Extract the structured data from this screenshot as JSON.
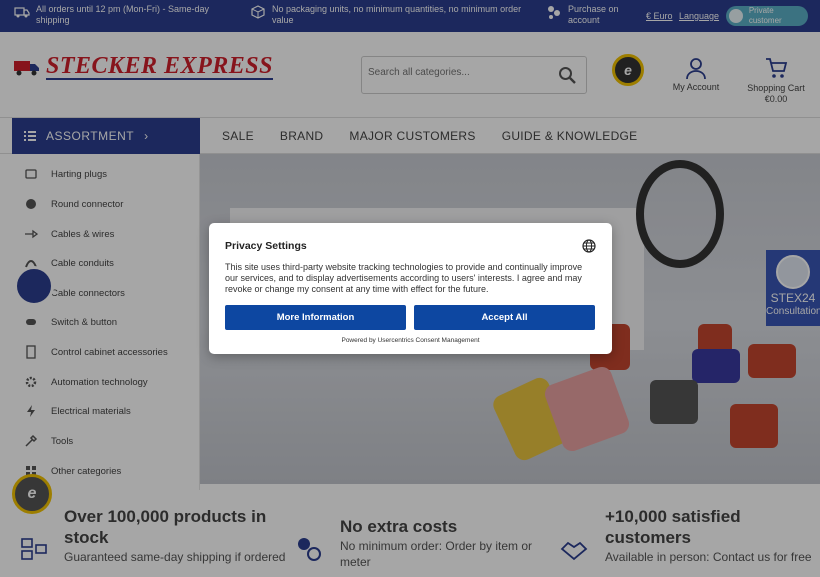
{
  "topbar": {
    "item1": "All orders until 12 pm (Mon-Fri) - Same-day shipping",
    "item2": "No packaging units, no minimum quantities, no minimum order value",
    "item3": "Purchase on account",
    "currency": "€ Euro",
    "language": "Language",
    "toggle_label": "Private customer"
  },
  "header": {
    "logo_part1": "STECKER ",
    "logo_part2": "EXPRESS",
    "search_placeholder": "Search all categories...",
    "trusted_mark": "e",
    "account_label": "My Account",
    "cart_label": "Shopping Cart",
    "cart_total": "€0.00"
  },
  "nav": {
    "assortment": "ASSORTMENT",
    "links": [
      "SALE",
      "BRAND",
      "MAJOR CUSTOMERS",
      "GUIDE & KNOWLEDGE"
    ]
  },
  "sidebar": {
    "items": [
      "Harting plugs",
      "Round connector",
      "Cables & wires",
      "Cable conduits",
      "Cable connectors",
      "Switch & button",
      "Control cabinet accessories",
      "Automation technology",
      "Electrical materials",
      "Tools",
      "Other categories"
    ]
  },
  "features": [
    {
      "title": "Over 100,000 products in stock",
      "sub": "Guaranteed same-day shipping if ordered"
    },
    {
      "title": "No extra costs",
      "sub": "No minimum order: Order by item or meter"
    },
    {
      "title": "+10,000 satisfied customers",
      "sub": "Available in person: Contact us for free"
    }
  ],
  "consultation": {
    "name": "STEX24",
    "label": "Consultation"
  },
  "privacy": {
    "title": "Privacy Settings",
    "text": "This site uses third-party website tracking technologies to provide and continually improve our services, and to display advertisements according to users' interests. I agree and may revoke or change my consent at any time with effect for the future.",
    "more_info": "More Information",
    "accept_all": "Accept All",
    "powered_by": "Powered by Usercentrics Consent Management"
  },
  "colors": {
    "brand_blue": "#2c3e8f",
    "logo_red": "#d0202b",
    "button_blue": "#0d47a1"
  }
}
